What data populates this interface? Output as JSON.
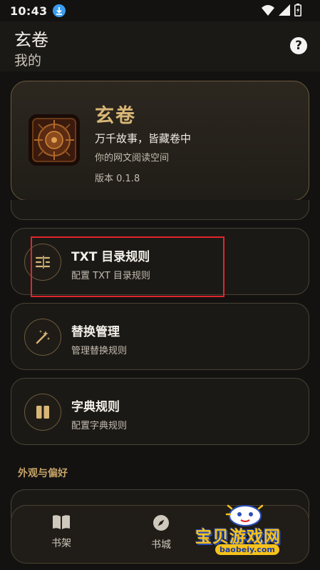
{
  "status_bar": {
    "time": "10:43"
  },
  "header": {
    "title": "玄卷",
    "subtitle": "我的"
  },
  "about": {
    "name": "玄卷",
    "slogan": "万千故事，皆藏卷中",
    "description": "你的网文阅读空间",
    "version": "版本 0.1.8"
  },
  "settings": [
    {
      "title": "TXT 目录规则",
      "subtitle": "配置 TXT 目录规则",
      "icon": "list-rules-icon"
    },
    {
      "title": "替换管理",
      "subtitle": "管理替换规则",
      "icon": "magic-wand-icon"
    },
    {
      "title": "字典规则",
      "subtitle": "配置字典规则",
      "icon": "pause-icon"
    }
  ],
  "section": {
    "appearance_title": "外观与偏好"
  },
  "bottom_nav": [
    {
      "label": "书架",
      "icon": "book-open-icon"
    },
    {
      "label": "书城",
      "icon": "compass-icon"
    }
  ],
  "watermark": {
    "text": "宝贝游戏网",
    "url": "baobeiy.com"
  },
  "colors": {
    "accent": "#d8b676",
    "background": "#131211",
    "card": "#1b1916",
    "highlight": "#e0262c"
  }
}
